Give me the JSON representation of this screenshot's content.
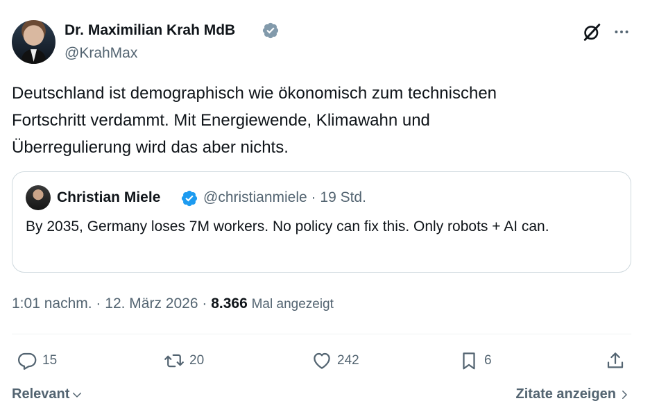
{
  "author": {
    "name": "Dr. Maximilian Krah MdB",
    "handle": "@KrahMax",
    "verified_color": "#829aab"
  },
  "tweet": {
    "text_lines": [
      "Deutschland ist demographisch wie ökonomisch zum technischen",
      "Fortschritt verdammt. Mit Energiewende, Klimawahn und",
      "Überregulierung wird das aber nichts."
    ]
  },
  "quote": {
    "name": "Christian Miele",
    "handle": "@christianmiele",
    "separator": "·",
    "time": "19 Std.",
    "text": "By 2035, Germany loses 7M workers. No policy can fix this. Only robots + AI can.",
    "verified_color": "#1d9bf0"
  },
  "meta": {
    "time": "1:01 nachm.",
    "separator": "·",
    "date": "12. März 2026",
    "views": "8.366",
    "views_label": "Mal angezeigt"
  },
  "actions": {
    "replies": "15",
    "reposts": "20",
    "likes": "242",
    "bookmarks": "6"
  },
  "footer": {
    "sort_label": "Relevant",
    "quotes_label": "Zitate anzeigen"
  },
  "icons": {
    "reply": "reply-icon",
    "repost": "repost-icon",
    "like": "heart-icon",
    "bookmark": "bookmark-icon",
    "share": "share-icon",
    "grok": "grok-icon",
    "more": "more-icon"
  }
}
